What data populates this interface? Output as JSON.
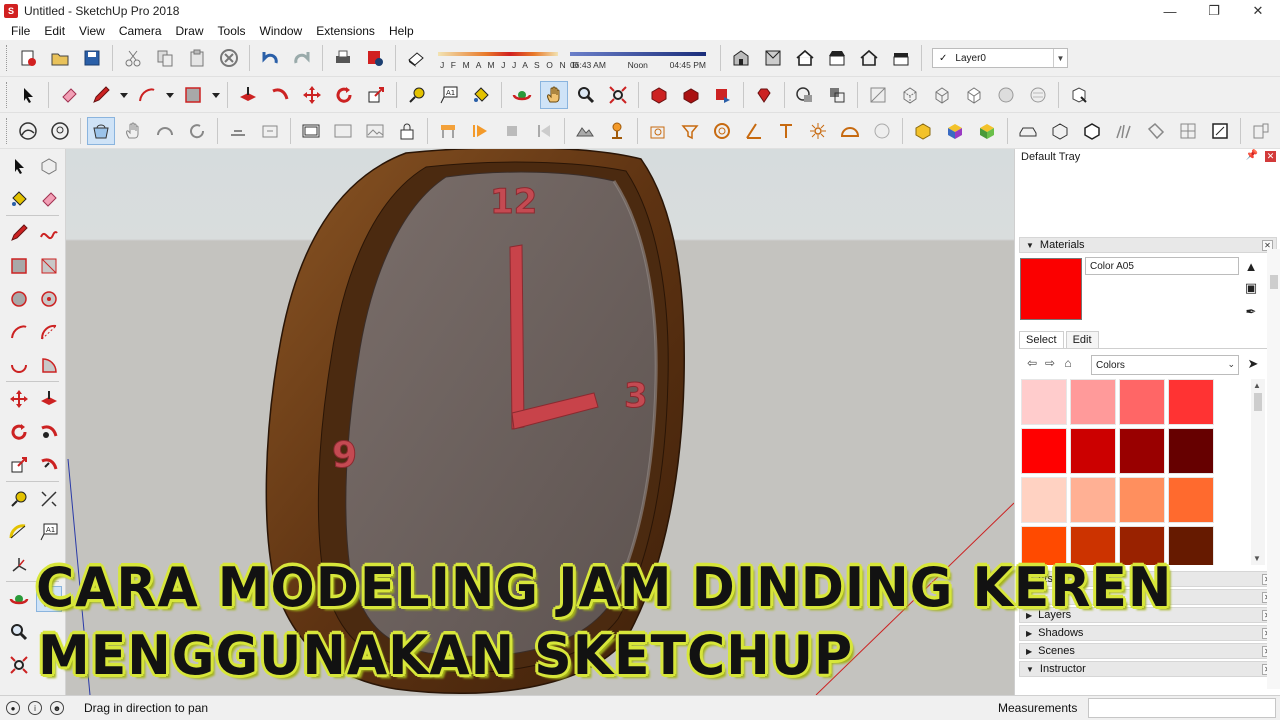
{
  "window": {
    "title": "Untitled - SketchUp Pro 2018"
  },
  "menu": [
    "File",
    "Edit",
    "View",
    "Camera",
    "Draw",
    "Tools",
    "Window",
    "Extensions",
    "Help"
  ],
  "shadows": {
    "months": "J F M A M J J A S O N D",
    "time_start": "06:43 AM",
    "time_mid": "Noon",
    "time_end": "04:45 PM"
  },
  "layers": {
    "check": "✓",
    "current": "Layer0"
  },
  "clock_numerals": {
    "twelve": "12",
    "three": "3",
    "nine": "9"
  },
  "caption": {
    "line1": "CARA MODELING JAM DINDING KEREN",
    "line2": "MENGGUNAKAN SKETCHUP"
  },
  "tray": {
    "title": "Default Tray",
    "materials": {
      "header": "Materials",
      "name": "Color A05",
      "swatch_color": "#fb0000",
      "tabs": [
        "Select",
        "Edit"
      ],
      "collection": "Colors",
      "swatches": [
        "#ffcccc",
        "#ff9a9a",
        "#ff6666",
        "#ff3333",
        "#ff0000",
        "#cc0000",
        "#990000",
        "#660000",
        "#ffd2c2",
        "#ffb094",
        "#ff8f5e",
        "#ff6a2e",
        "#ff4a00",
        "#cc3300",
        "#992200",
        "#661a00"
      ]
    },
    "panels": [
      {
        "label": "nts",
        "expanded": false
      },
      {
        "label": "",
        "expanded": false
      },
      {
        "label": "Layers",
        "expanded": false
      },
      {
        "label": "Shadows",
        "expanded": false
      },
      {
        "label": "Scenes",
        "expanded": false
      },
      {
        "label": "Instructor",
        "expanded": true
      }
    ]
  },
  "status": {
    "hint": "Drag in direction to pan",
    "measurements_label": "Measurements",
    "measurements_value": ""
  },
  "colors": {
    "accent_red": "#d12020",
    "caption_yellow": "#d7e63a",
    "wood": "#6b3a15"
  }
}
